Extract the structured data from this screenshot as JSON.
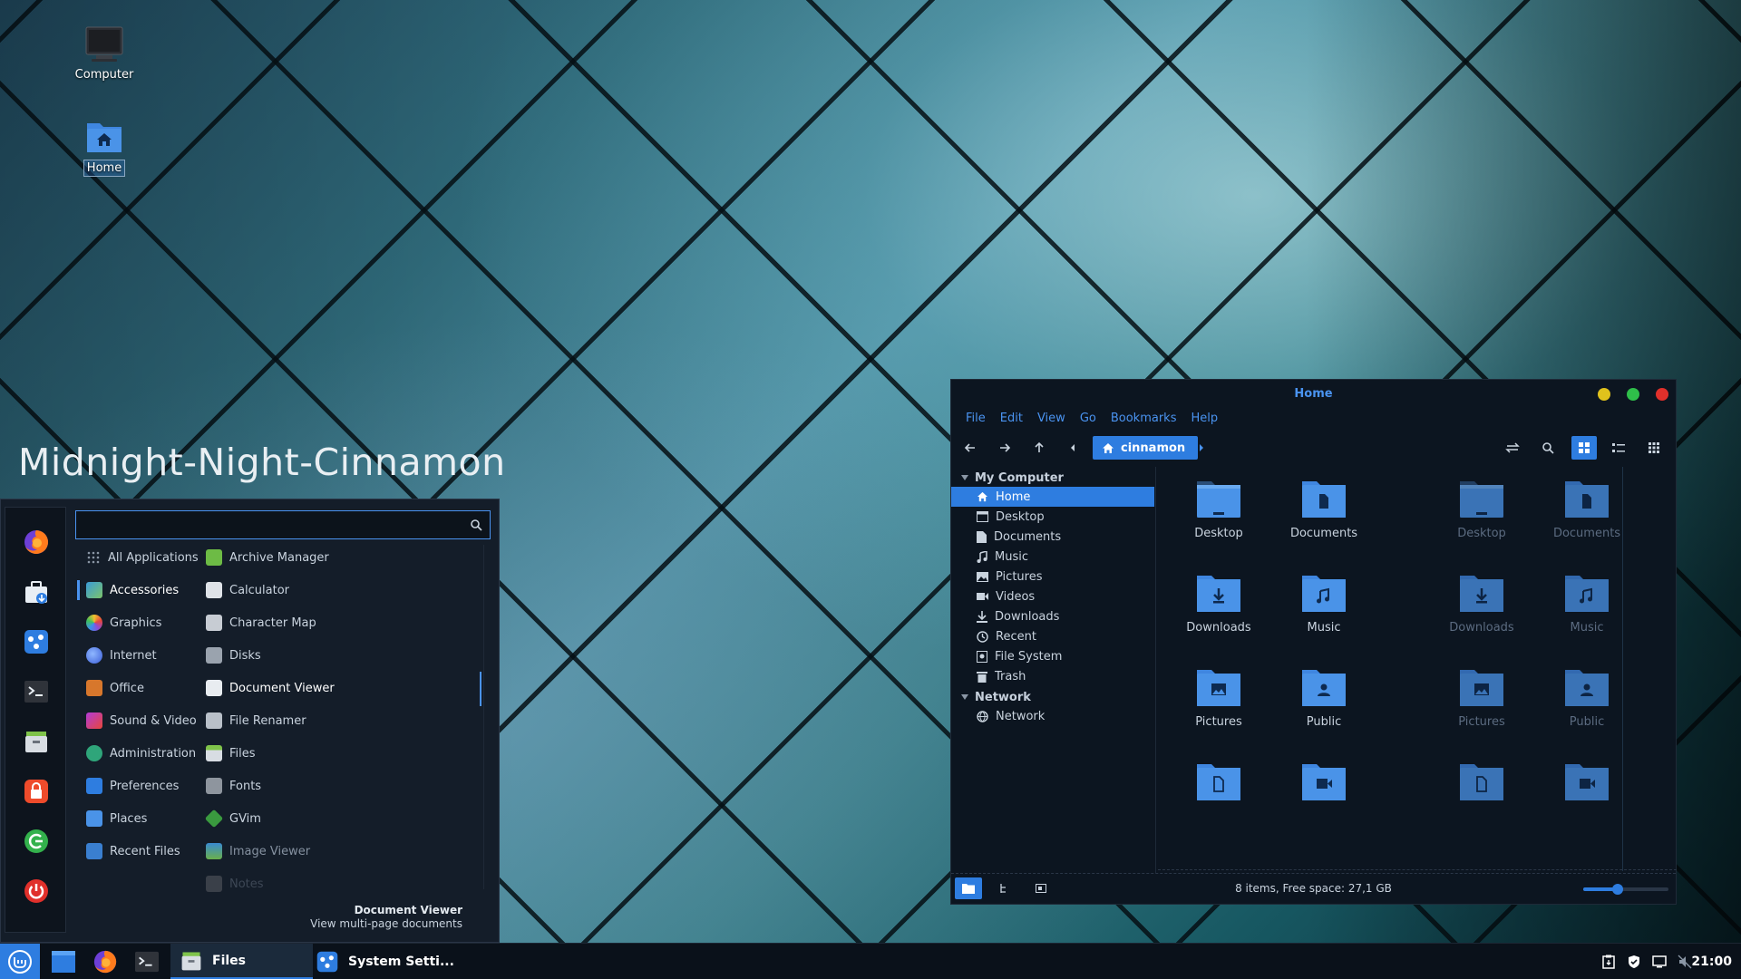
{
  "desktop": {
    "caption": "Midnight-Night-Cinnamon",
    "icons": [
      {
        "label": "Computer",
        "icon": "monitor-icon"
      },
      {
        "label": "Home",
        "icon": "home-folder-icon"
      }
    ]
  },
  "menu": {
    "search": {
      "placeholder": "",
      "value": ""
    },
    "favorites": [
      "firefox-icon",
      "software-manager-icon",
      "system-settings-icon",
      "terminal-icon",
      "files-icon",
      "lock-icon",
      "logout-icon",
      "power-icon"
    ],
    "categories": [
      {
        "label": "All Applications",
        "icon": "grid-icon"
      },
      {
        "label": "Accessories",
        "icon": "accessories-icon"
      },
      {
        "label": "Graphics",
        "icon": "graphics-icon"
      },
      {
        "label": "Internet",
        "icon": "internet-icon"
      },
      {
        "label": "Office",
        "icon": "office-icon"
      },
      {
        "label": "Sound & Video",
        "icon": "multimedia-icon"
      },
      {
        "label": "Administration",
        "icon": "administration-icon"
      },
      {
        "label": "Preferences",
        "icon": "preferences-icon"
      },
      {
        "label": "Places",
        "icon": "folder-icon"
      },
      {
        "label": "Recent Files",
        "icon": "recent-files-icon"
      }
    ],
    "apps": [
      {
        "label": "Archive Manager",
        "icon": "archive-icon"
      },
      {
        "label": "Calculator",
        "icon": "calculator-icon"
      },
      {
        "label": "Character Map",
        "icon": "charmap-icon"
      },
      {
        "label": "Disks",
        "icon": "disks-icon"
      },
      {
        "label": "Document Viewer",
        "icon": "document-viewer-icon"
      },
      {
        "label": "File Renamer",
        "icon": "file-renamer-icon"
      },
      {
        "label": "Files",
        "icon": "files-icon"
      },
      {
        "label": "Fonts",
        "icon": "fonts-icon"
      },
      {
        "label": "GVim",
        "icon": "gvim-icon"
      },
      {
        "label": "Image Viewer",
        "icon": "image-viewer-icon"
      },
      {
        "label": "Notes",
        "icon": "notes-icon"
      }
    ],
    "description": {
      "title": "Document Viewer",
      "text": "View multi-page documents"
    }
  },
  "files_window": {
    "title": "Home",
    "menubar": [
      "File",
      "Edit",
      "View",
      "Go",
      "Bookmarks",
      "Help"
    ],
    "breadcrumb": "cinnamon",
    "sidebar": {
      "sections": [
        {
          "title": "My Computer",
          "items": [
            "Home",
            "Desktop",
            "Documents",
            "Music",
            "Pictures",
            "Videos",
            "Downloads",
            "Recent",
            "File System",
            "Trash"
          ]
        },
        {
          "title": "Network",
          "items": [
            "Network"
          ]
        }
      ],
      "selected": "Home"
    },
    "left_pane": [
      "Desktop",
      "Documents",
      "Downloads",
      "Music",
      "Pictures",
      "Public",
      "",
      ""
    ],
    "right_pane": [
      "Desktop",
      "Documents",
      "Downloads",
      "Music",
      "Pictures",
      "Public",
      "",
      ""
    ],
    "status": "8 items, Free space: 27,1 GB",
    "zoom_fraction": 0.4,
    "colors": {
      "accent": "#2e7de0",
      "folder": "#4a93e8",
      "close": "#e0302b",
      "minimize": "#e0c21c",
      "maximize": "#2fbf4a"
    }
  },
  "taskbar": {
    "windows": [
      {
        "label": "Files",
        "active": true
      },
      {
        "label": "System Setti...",
        "active": false
      }
    ],
    "clock": "21:00"
  }
}
